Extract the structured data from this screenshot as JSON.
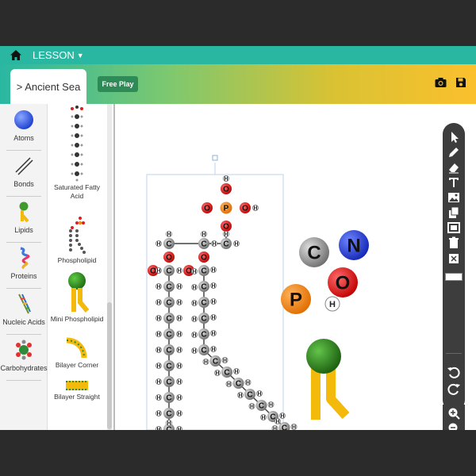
{
  "header": {
    "lesson_label": "LESSON"
  },
  "tabs": {
    "active_label": "> Ancient Sea",
    "free_play_label": "Free Play"
  },
  "sidebar": {
    "items": [
      {
        "label": "Atoms"
      },
      {
        "label": "Bonds"
      },
      {
        "label": "Lipids"
      },
      {
        "label": "Proteins"
      },
      {
        "label": "Nucleic Acids"
      },
      {
        "label": "Carbohydrates"
      }
    ]
  },
  "palette": {
    "items": [
      {
        "label": "Saturated Fatty Acid"
      },
      {
        "label": "Phospholipid"
      },
      {
        "label": "Mini Phospholipid"
      },
      {
        "label": "Bilayer Corner"
      },
      {
        "label": "Bilayer Straight"
      }
    ]
  },
  "canvas": {
    "atoms": [
      "C",
      "N",
      "O",
      "P",
      "H"
    ],
    "molecule_letters": {
      "carbon": "C",
      "oxygen": "O",
      "phosphorus": "P",
      "hydrogen": "H"
    }
  },
  "colors": {
    "teal": "#2ab7a1",
    "yellow": "#fbc02d",
    "carbon": "#808080",
    "oxygen": "#e01b1b",
    "nitrogen": "#1e3fd6",
    "phosphorus": "#f08a14",
    "toolbar": "#3d3d3d"
  }
}
